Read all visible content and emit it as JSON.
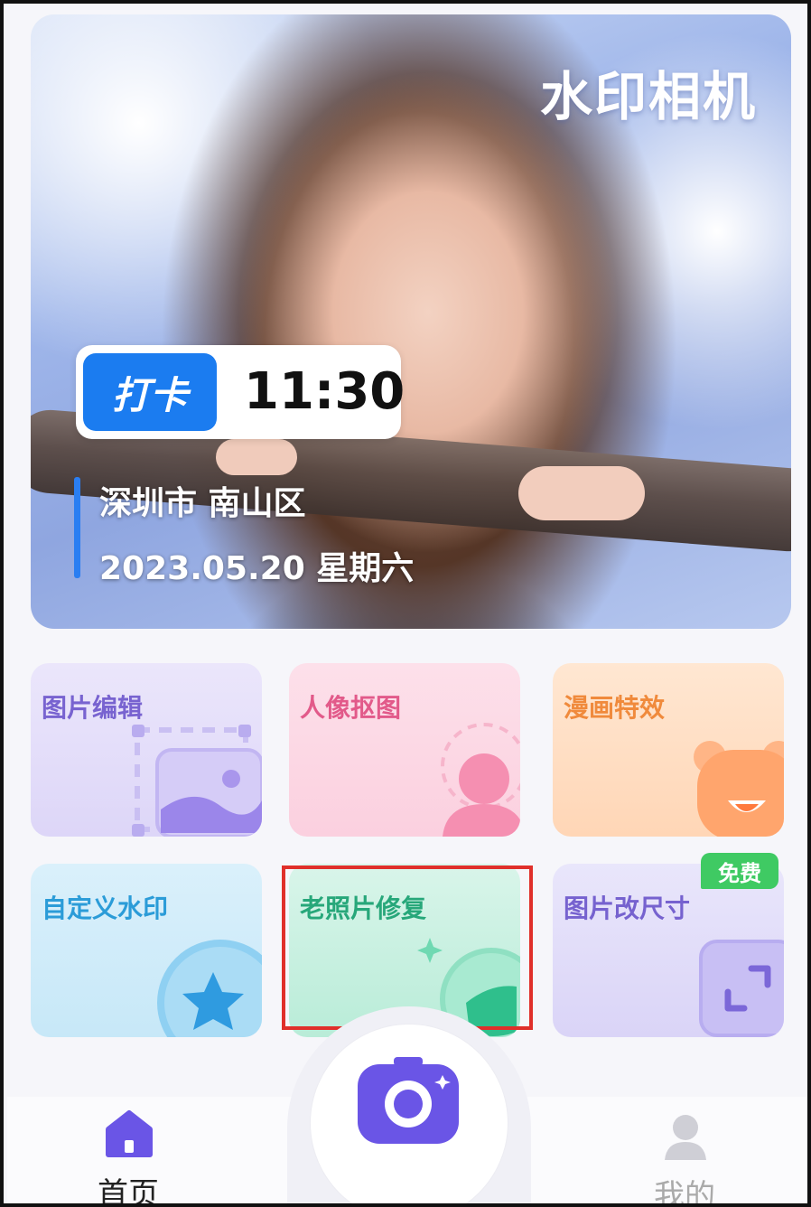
{
  "hero": {
    "title": "水印相机",
    "stamp_badge": "打卡",
    "stamp_time": "11:30",
    "location": "深圳市  南山区",
    "date": "2023.05.20   星期六"
  },
  "features": [
    {
      "label": "图片编辑",
      "icon": "image-edit-icon"
    },
    {
      "label": "人像抠图",
      "icon": "portrait-cutout-icon"
    },
    {
      "label": "漫画特效",
      "icon": "bear-icon"
    },
    {
      "label": "自定义水印",
      "icon": "star-icon"
    },
    {
      "label": "老照片修复",
      "icon": "old-photo-icon"
    },
    {
      "label": "图片改尺寸",
      "icon": "resize-icon"
    }
  ],
  "free_badge": "免费",
  "tabs": [
    {
      "label": "首页",
      "icon": "home-icon",
      "active": true
    },
    {
      "label": "我的",
      "icon": "profile-icon",
      "active": false
    }
  ],
  "colors": {
    "accent": "#1b7cf0",
    "highlight": "#e02f2a",
    "free": "#3fca63",
    "camera": "#6a55e6"
  }
}
